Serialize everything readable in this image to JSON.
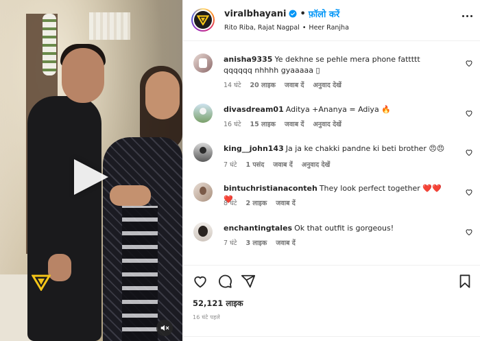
{
  "post": {
    "username": "viralbhayani",
    "dot": "•",
    "follow_label": "फ़ॉलो करें",
    "audio_artists": "Rito Riba, Rajat Nagpal",
    "audio_sep": "•",
    "audio_track": "Heer Ranjha"
  },
  "comments": [
    {
      "user": "anisha9335",
      "text": "Ye dekhne se pehle mera phone fattttt qqqqqq nhhhh gyaaaaa ",
      "time": "14 घंटे",
      "likes": "20 लाइक",
      "reply": "जवाब दें",
      "translate": "अनुवाद देखें"
    },
    {
      "user": "divasdream01",
      "text": "Aditya +Ananya = Adiya 🔥",
      "time": "16 घंटे",
      "likes": "15 लाइक",
      "reply": "जवाब दें",
      "translate": "अनुवाद देखें"
    },
    {
      "user": "king__john143",
      "text": "Ja ja ke chakki pandne ki beti brother 😠😠",
      "time": "7 घंटे",
      "likes": "1 पसंद",
      "reply": "जवाब दें",
      "translate": "अनुवाद देखें"
    },
    {
      "user": "bintuchristianaconteh",
      "text": "They look perfect together ❤️❤️❤️",
      "time": "8 घंटे",
      "likes": "2 लाइक",
      "reply": "जवाब दें"
    },
    {
      "user": "enchantingtales",
      "text": "Ok that outfit is gorgeous!",
      "time": "7 घंटे",
      "likes": "3 लाइक",
      "reply": "जवाब दें"
    }
  ],
  "actions": {
    "likes_count": "52,121 लाइक",
    "posted_ago": "16 घंटे पहले"
  },
  "colors": {
    "accent": "#0095f6",
    "text": "#262626",
    "muted": "#737373",
    "brand_yellow": "#f5c518"
  },
  "icons": [
    "heart-icon",
    "comment-icon",
    "share-icon",
    "bookmark-icon",
    "play-icon",
    "mute-icon",
    "verified-icon",
    "more-icon"
  ]
}
